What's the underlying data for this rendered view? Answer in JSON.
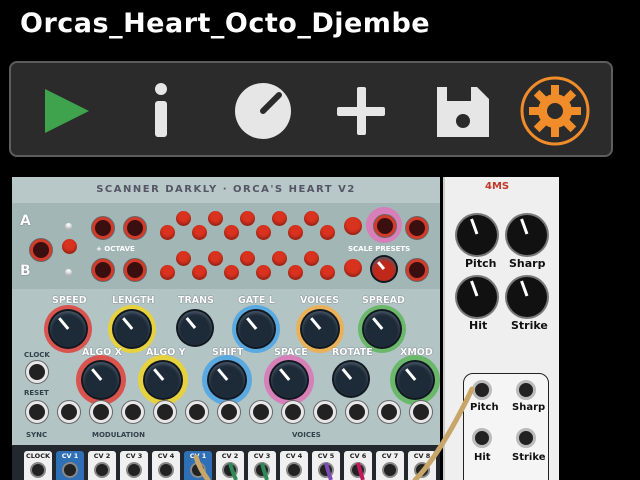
{
  "app": {
    "title": "Orcas_Heart_Octo_Djembe"
  },
  "toolbar": {
    "buttons": [
      {
        "name": "play-button",
        "icon": "play-icon",
        "color": "#3fa34d"
      },
      {
        "name": "info-button",
        "icon": "info-icon",
        "color": "#e6e6e6"
      },
      {
        "name": "knob-button",
        "icon": "knob-icon",
        "color": "#e6e6e6"
      },
      {
        "name": "add-button",
        "icon": "plus-icon",
        "color": "#e6e6e6"
      },
      {
        "name": "save-button",
        "icon": "floppy-disk-icon",
        "color": "#e6e6e6"
      },
      {
        "name": "settings-button",
        "icon": "gear-icon",
        "color": "#f08c2a"
      }
    ]
  },
  "main_module": {
    "header": "SCANNER DARKLY · ORCA'S HEART V2",
    "row_a": "A",
    "row_b": "B",
    "octave_label": "+ OCTAVE",
    "scale_presets_label": "SCALE PRESETS",
    "knob_labels_row1": [
      "SPEED",
      "LENGTH",
      "TRANS",
      "GATE L",
      "VOICES",
      "SPREAD"
    ],
    "knob_labels_row2": [
      "ALGO X",
      "ALGO Y",
      "SHIFT",
      "SPACE",
      "ROTATE",
      "XMOD"
    ],
    "clock_label": "CLOCK",
    "reset_label": "RESET",
    "sync_label": "SYNC",
    "modulation_label": "MODULATION",
    "voices_label": "VOICES",
    "bottom_jacks": [
      "CLOCK",
      "CV 1",
      "CV 2",
      "CV 3",
      "CV 4",
      "CV 1",
      "CV 2",
      "CV 3",
      "CV 4",
      "CV 5",
      "CV 6",
      "CV 7",
      "CV 8"
    ]
  },
  "side_module": {
    "logo": "4MS",
    "knobs": [
      "Pitch",
      "Sharp",
      "Hit",
      "Strike"
    ],
    "jacks": [
      "Pitch",
      "Sharp",
      "Hit",
      "Strike"
    ]
  }
}
